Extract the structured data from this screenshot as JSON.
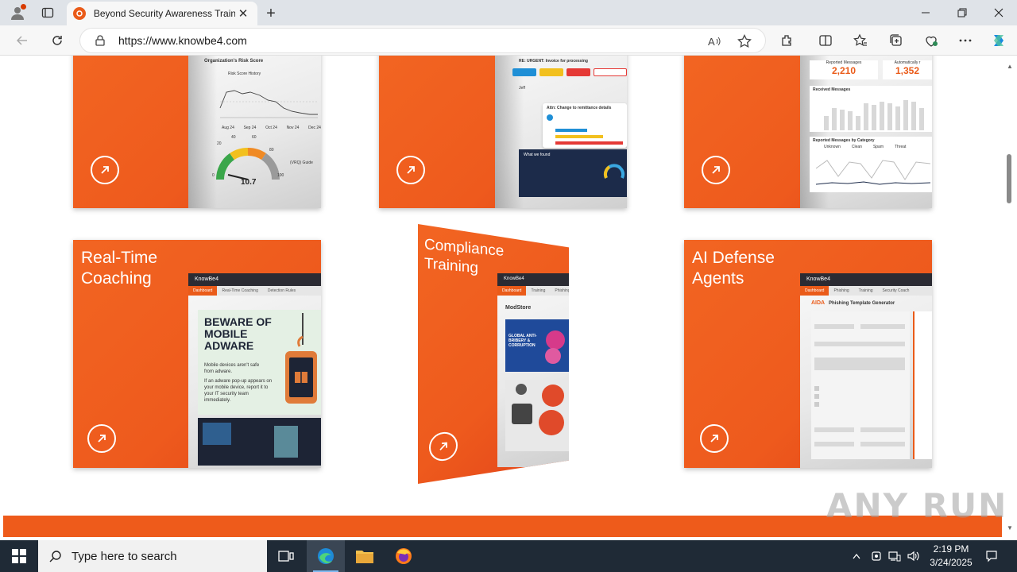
{
  "browser": {
    "tab_title": "Beyond Security Awareness Training",
    "url": "https://www.knowbe4.com",
    "new_tab_label": "+",
    "close_tab_label": "✕"
  },
  "cards_top": [
    {
      "name": "risk-score-card",
      "shot_title": "Organization's Risk Score",
      "chart_title": "Risk Score History",
      "months": [
        "Aug 24",
        "Sep 24",
        "Oct 24",
        "Nov 24",
        "Dec 24"
      ],
      "gauge_value": "10.7",
      "gauge_ticks": [
        "0",
        "20",
        "40",
        "60",
        "80",
        "100"
      ],
      "vrq": "(VRQ) Guide"
    },
    {
      "name": "phishing-email-card",
      "subject": "RE: URGENT: Invoice for processing",
      "reply": "Attn: Change to remittance details",
      "sender": "Jeff",
      "panel": "What we found"
    },
    {
      "name": "reported-messages-card",
      "reported_label": "Reported Messages",
      "reported_value": "2,210",
      "auto_label": "Automatically r",
      "auto_value": "1,352",
      "received_label": "Received Messages",
      "category_label": "Reported Messages by Category",
      "categories": [
        "Unknown",
        "Clean",
        "Spam",
        "Threat"
      ]
    }
  ],
  "cards_bottom": [
    {
      "name": "real-time-coaching-card",
      "title": "Real-Time Coaching",
      "brand": "KnowBe4",
      "tabs": [
        "Dashboard",
        "Real-Time Coaching",
        "Detection Rules"
      ],
      "poster_title": "BEWARE OF MOBILE ADWARE",
      "poster_text_1": "Mobile devices aren't safe from adware.",
      "poster_text_2": "If an adware pop-up appears on your mobile device, report it to your IT security team immediately."
    },
    {
      "name": "compliance-training-card",
      "title": "Compliance Training",
      "brand": "KnowBe4",
      "tabs": [
        "Dashboard",
        "Training",
        "Phishing"
      ],
      "store": "ModStore",
      "course": "GLOBAL ANTI-BRIBERY & CORRUPTION"
    },
    {
      "name": "ai-defense-agents-card",
      "title": "AI Defense Agents",
      "brand": "KnowBe4",
      "tabs": [
        "Dashboard",
        "Phishing",
        "Training",
        "Security Coach"
      ],
      "aida": "AIDA",
      "generator": "Phishing Template Generator"
    }
  ],
  "watermark": "ANY RUN",
  "taskbar": {
    "search_placeholder": "Type here to search",
    "time": "2:19 PM",
    "date": "3/24/2025"
  },
  "colors": {
    "brand_orange": "#f26522",
    "taskbar": "#1f2a36"
  }
}
